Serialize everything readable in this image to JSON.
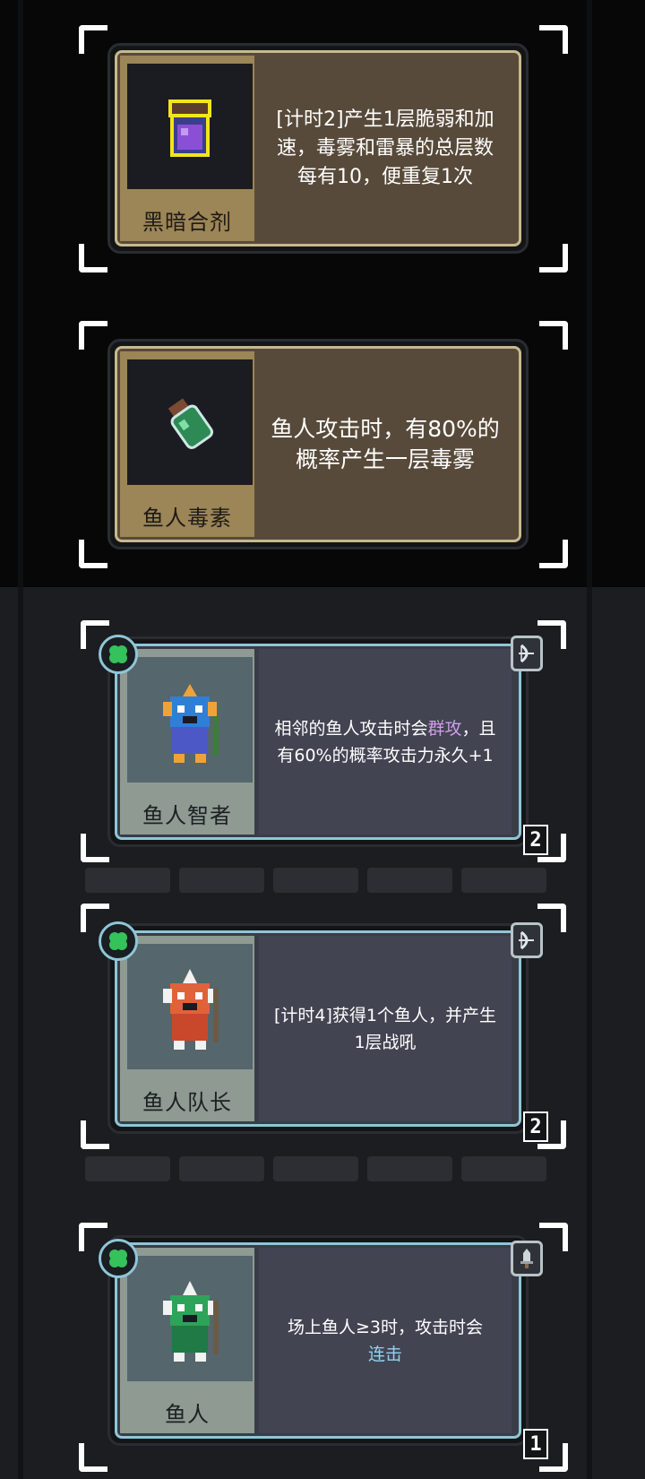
{
  "colors": {
    "highlight_purple": "#d09de9",
    "highlight_blue": "#8fd3ef"
  },
  "items": [
    {
      "name": "黑暗合剂",
      "icon": "dark-potion-icon",
      "description": "[计时2]产生1层脆弱和加速，毒雾和雷暴的总层数每有10，便重复1次"
    },
    {
      "name": "鱼人毒素",
      "icon": "poison-bottle-icon",
      "description": "鱼人攻击时，有80%的概率产生一层毒雾"
    }
  ],
  "units": [
    {
      "name": "鱼人智者",
      "icon": "murloc-sage-icon",
      "desc_before": "相邻的鱼人攻击时会",
      "desc_highlight": "群攻",
      "desc_after": "，且有60%的概率攻击力永久+1",
      "level": "2",
      "class_icon": "bow-icon"
    },
    {
      "name": "鱼人队长",
      "icon": "murloc-captain-icon",
      "desc_before": "[计时4]获得1个鱼人，并产生1层战吼",
      "desc_highlight": "",
      "desc_after": "",
      "level": "2",
      "class_icon": "bow-icon"
    },
    {
      "name": "鱼人",
      "icon": "murloc-icon",
      "desc_before": "场上鱼人≥3时，攻击时会",
      "desc_highlight": "连击",
      "desc_after": "",
      "level": "1",
      "class_icon": "sword-icon"
    }
  ]
}
